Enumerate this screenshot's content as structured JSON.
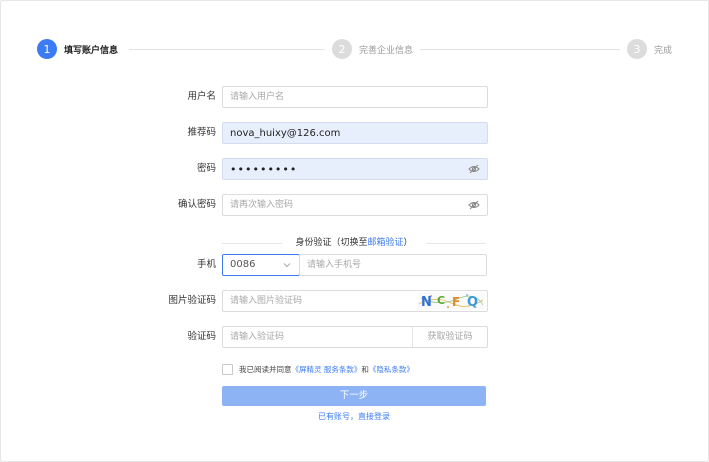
{
  "steps": [
    {
      "number": "1",
      "label": "填写账户信息"
    },
    {
      "number": "2",
      "label": "完善企业信息"
    },
    {
      "number": "3",
      "label": "完成"
    }
  ],
  "form": {
    "username": {
      "label": "用户名",
      "placeholder": "请输入用户名",
      "value": ""
    },
    "referral": {
      "label": "推荐码",
      "placeholder": "",
      "value": "nova_huixy@126.com"
    },
    "password": {
      "label": "密码",
      "placeholder": "",
      "value": "•••••••••"
    },
    "confirm": {
      "label": "确认密码",
      "placeholder": "请再次输入密码",
      "value": ""
    }
  },
  "verify": {
    "heading_prefix": "身份验证（切换至",
    "heading_link": "邮箱验证",
    "heading_suffix": "）",
    "phone_label": "手机",
    "country_code": "0086",
    "phone_placeholder": "请输入手机号",
    "captcha_label": "图片验证码",
    "captcha_placeholder": "请输入图片验证码",
    "captcha_text": "NCFQ",
    "sms_label": "验证码",
    "sms_placeholder": "请输入验证码",
    "sms_button": "获取验证码"
  },
  "agreement": {
    "prefix": "我已阅读并同意",
    "terms": "《屏精灵 服务条款》",
    "and": "和",
    "privacy": "《隐私条款》"
  },
  "next_button": "下一步",
  "login_link": "已有账号，直接登录",
  "colors": {
    "primary": "#3b7cf4",
    "button_disabled": "#8db3f5",
    "autofill": "#e8effc"
  }
}
